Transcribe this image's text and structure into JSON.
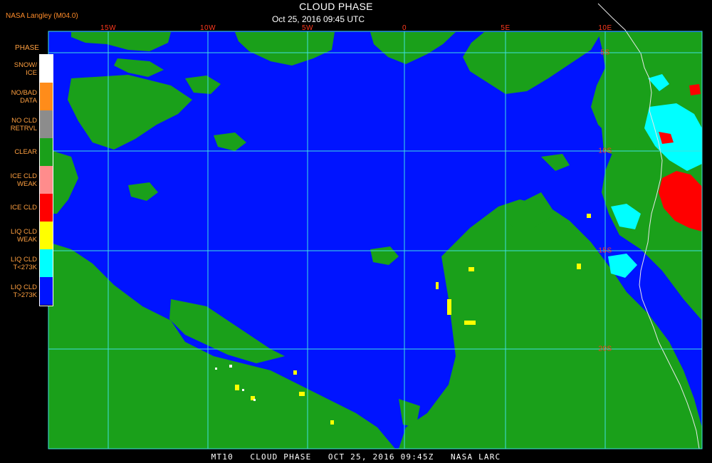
{
  "header": {
    "source": "NASA Langley (M04.0)",
    "title": "CLOUD PHASE",
    "time": "Oct 25, 2016 09:45 UTC"
  },
  "footer": {
    "text": "MT10   CLOUD PHASE   OCT 25, 2016 09:45Z   NASA LARC"
  },
  "legend": {
    "title": "PHASE",
    "items": [
      {
        "label": "SNOW/\nICE",
        "color": "#ffffff"
      },
      {
        "label": "NO/BAD\nDATA",
        "color": "#ff8c1a"
      },
      {
        "label": "NO CLD\nRETRVL",
        "color": "#8c8c8c"
      },
      {
        "label": "CLEAR",
        "color": "#1aa01a"
      },
      {
        "label": "ICE CLD\nWEAK",
        "color": "#ff8c8c"
      },
      {
        "label": "ICE CLD",
        "color": "#ff0000"
      },
      {
        "label": "LIQ CLD\nWEAK",
        "color": "#ffff00"
      },
      {
        "label": "LIQ CLD\nT<273K",
        "color": "#00ffff"
      },
      {
        "label": "LIQ CLD\nT>273K",
        "color": "#0014ff"
      }
    ]
  },
  "grid": {
    "longitudes": [
      {
        "label": "15W"
      },
      {
        "label": "10W"
      },
      {
        "label": "5W"
      },
      {
        "label": "0"
      },
      {
        "label": "5E"
      },
      {
        "label": "10E"
      }
    ],
    "latitudes": [
      {
        "label": "5S"
      },
      {
        "label": "10S"
      },
      {
        "label": "15S"
      },
      {
        "label": "20S"
      }
    ]
  },
  "colors": {
    "ocean_liquid": "#0014ff",
    "clear": "#1aa01a",
    "ice": "#ff0000",
    "liq_cold": "#00ffff",
    "liq_weak": "#ffff00",
    "grid": "#40e0e0",
    "coast": "#e8e8e8",
    "label": "#ff3a1f"
  }
}
